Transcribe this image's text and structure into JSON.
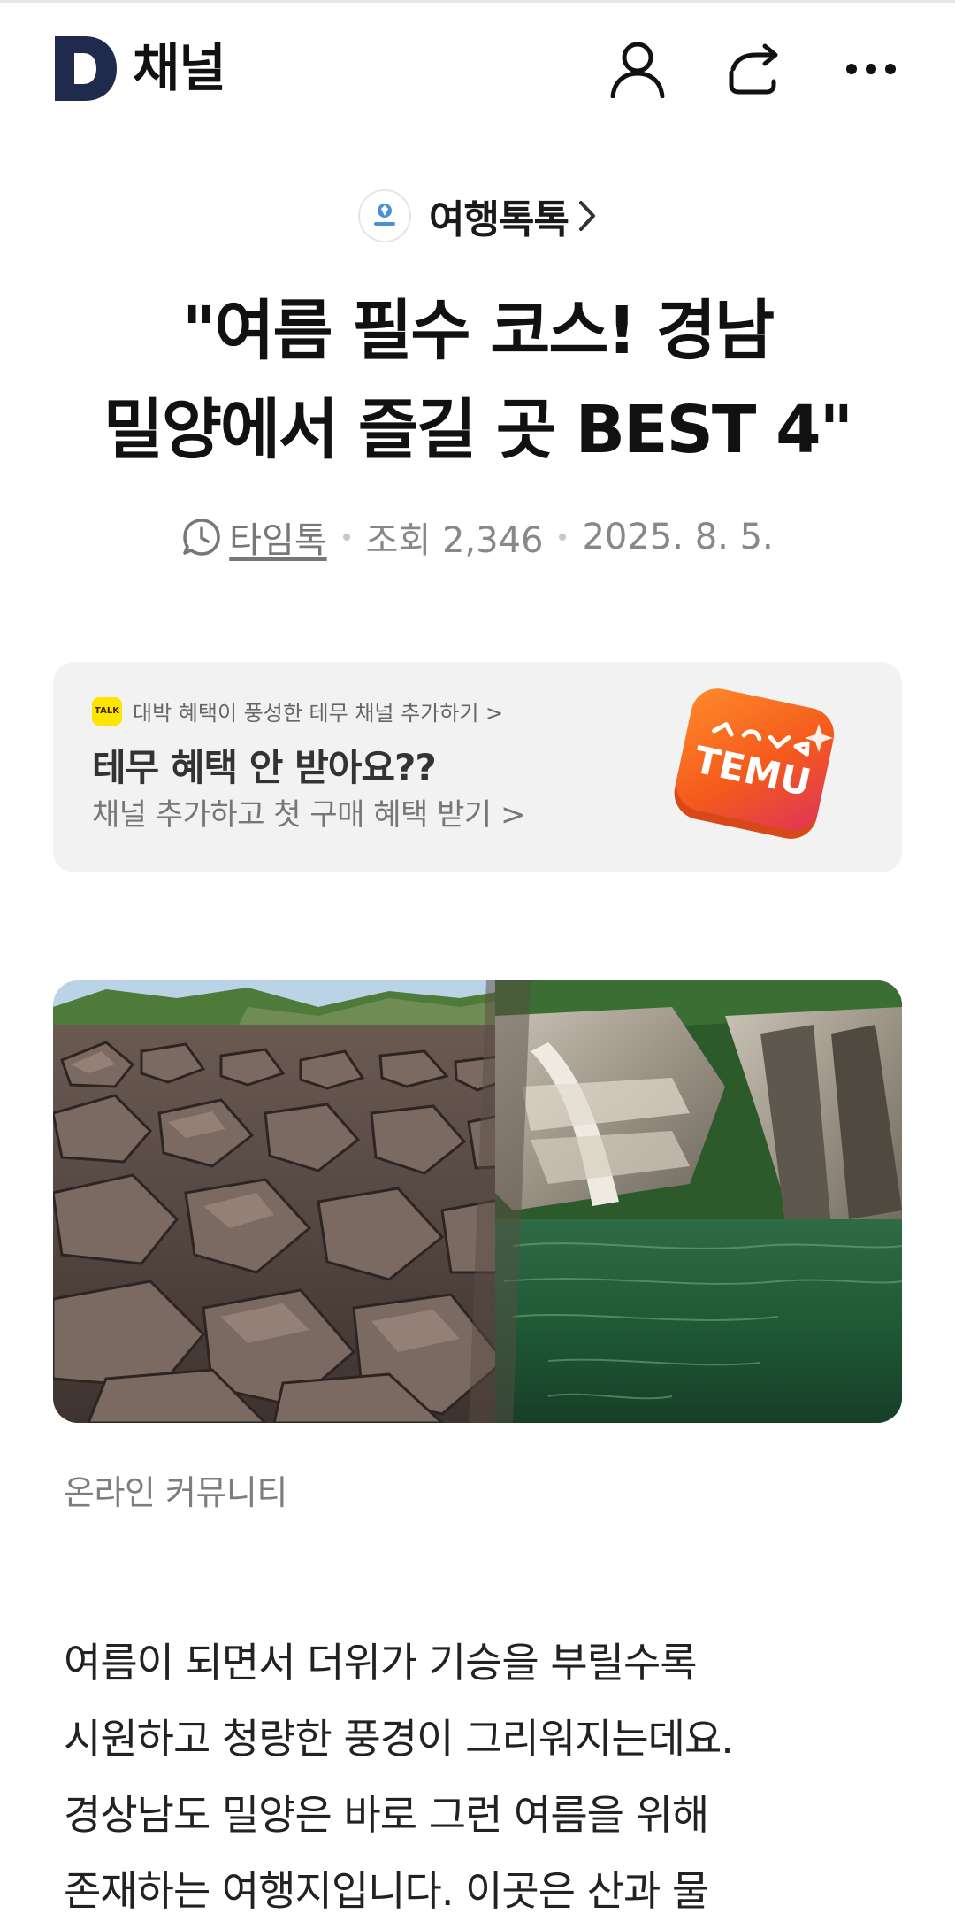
{
  "header": {
    "brand": "채널",
    "icons": [
      "user-icon",
      "share-icon",
      "more-icon"
    ]
  },
  "channel": {
    "name": "여행톡톡"
  },
  "article": {
    "title_line1": "\"여름 필수 코스! 경남",
    "title_line2": "밀양에서 즐길 곳 BEST 4\"",
    "author": "타임톡",
    "views": "조회 2,346",
    "date": "2025. 8. 5."
  },
  "ad": {
    "badge": "TALK",
    "top_text": "대박 혜택이 풍성한 테무 채널 추가하기 >",
    "title": "테무 혜택 안 받아요??",
    "subtitle": "채널 추가하고 첫 구매 혜택 받기 >",
    "logo_text": "TEMU"
  },
  "image": {
    "caption": "온라인 커뮤니티"
  },
  "body": {
    "line1": "여름이 되면서 더위가 기승을 부릴수록",
    "line2": "시원하고 청량한 풍경이 그리워지는데요.",
    "line3": "경상남도 밀양은 바로 그런 여름을 위해",
    "line4": "존재하는 여행지입니다. 이곳은 산과 물"
  },
  "colors": {
    "brand_navy": "#1f2a4d",
    "ad_background": "#f2f2f2",
    "talk_yellow": "#fee500",
    "temu_orange": "#f45a1c"
  }
}
